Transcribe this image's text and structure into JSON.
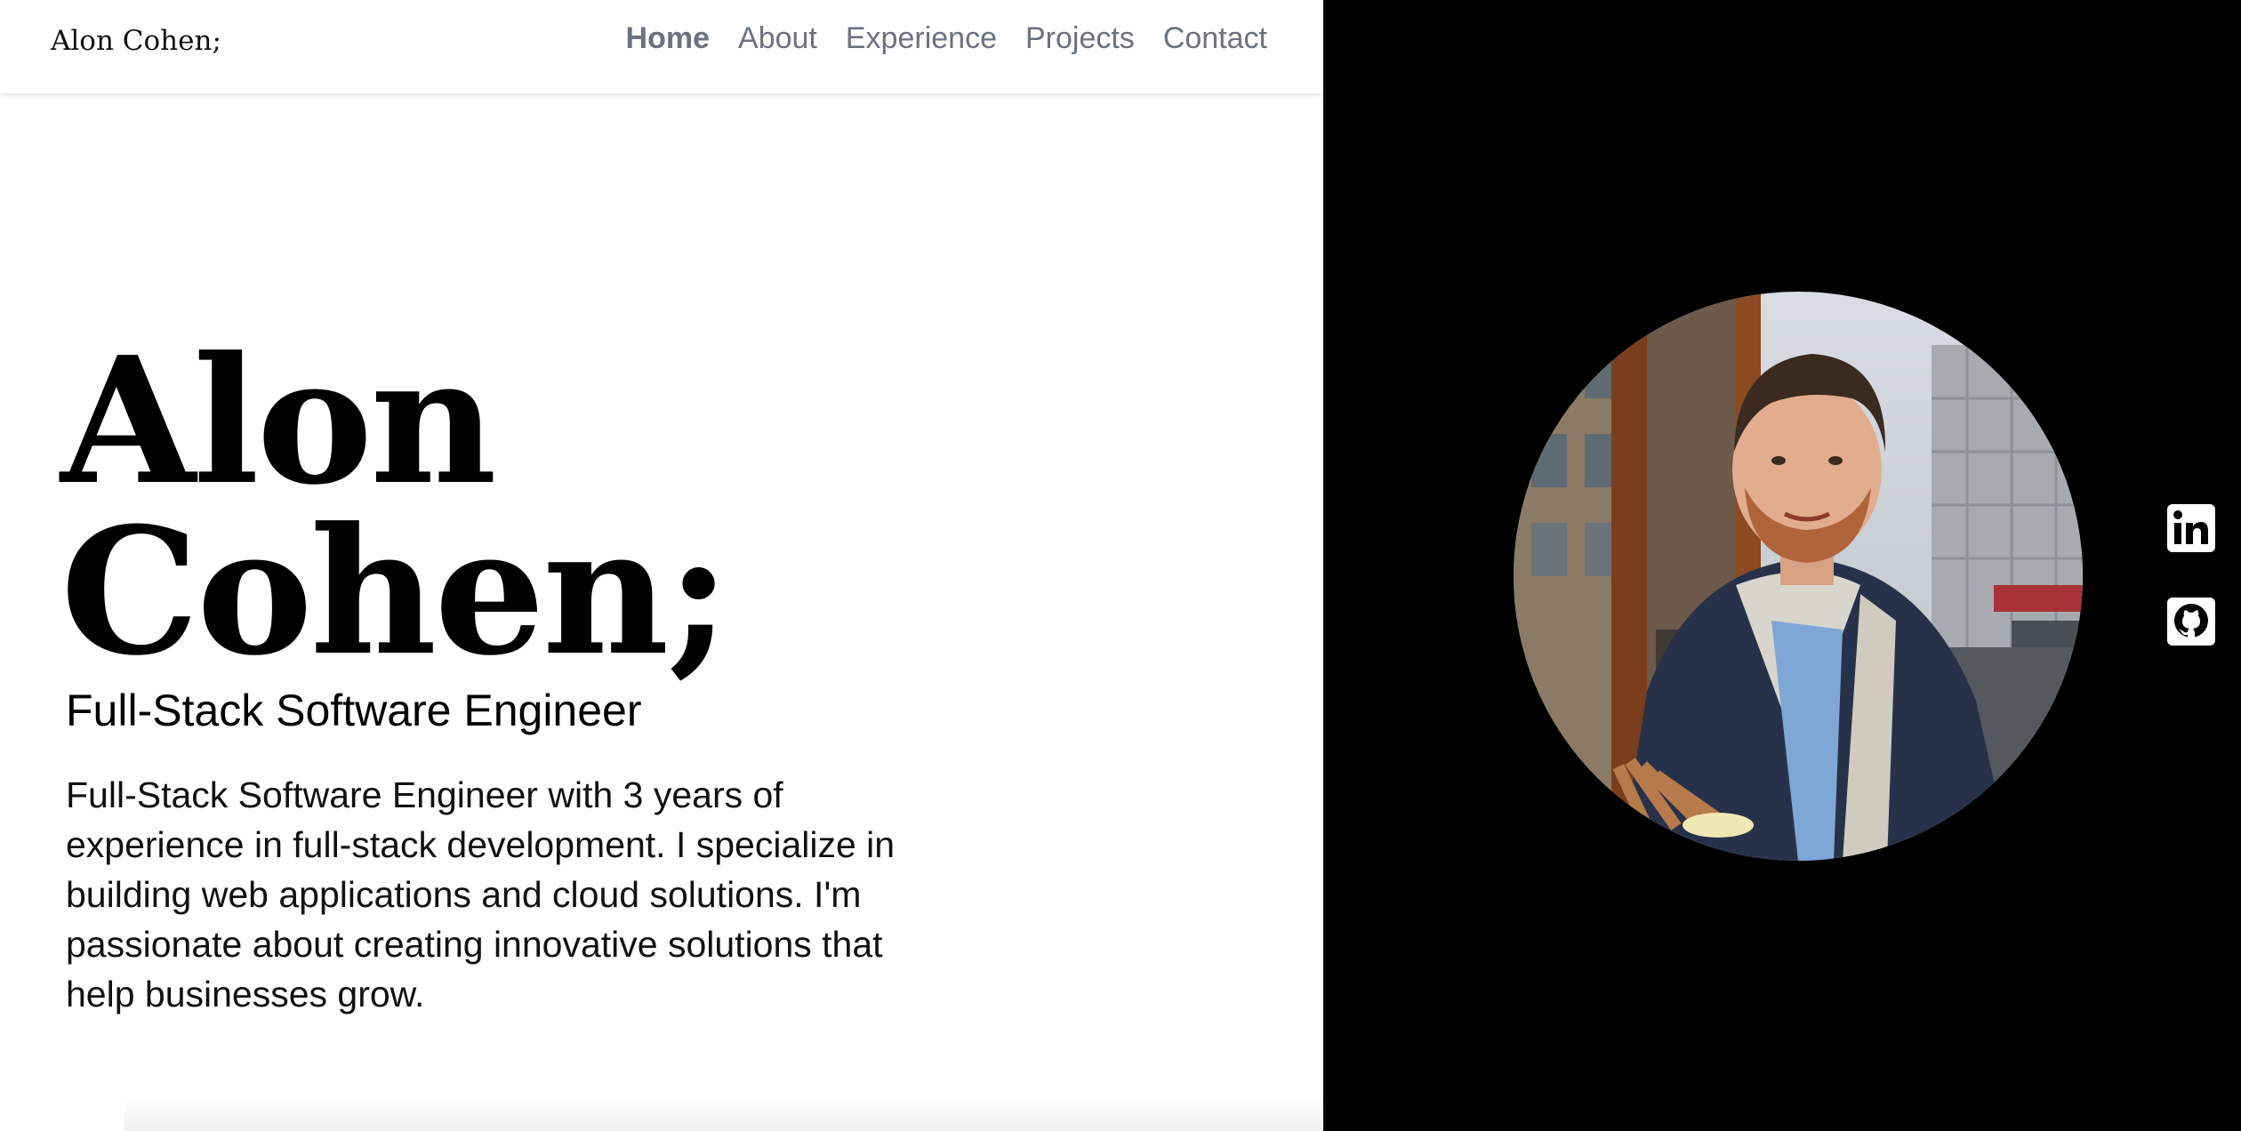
{
  "header": {
    "brand": "Alon Cohen;",
    "nav": [
      {
        "label": "Home",
        "active": true
      },
      {
        "label": "About",
        "active": false
      },
      {
        "label": "Experience",
        "active": false
      },
      {
        "label": "Projects",
        "active": false
      },
      {
        "label": "Contact",
        "active": false
      }
    ]
  },
  "hero": {
    "name_line1": "Alon",
    "name_line2": "Cohen;",
    "subtitle": "Full-Stack Software Engineer",
    "bio": "Full-Stack Software Engineer with 3 years of experience in full-stack development. I specialize in building web applications and cloud solutions. I'm passionate about creating innovative solutions that help businesses grow."
  },
  "side": {
    "social": [
      {
        "icon": "linkedin-icon"
      },
      {
        "icon": "github-icon"
      }
    ]
  },
  "colors": {
    "nav_text": "#6b7280",
    "left_bg": "#ffffff",
    "right_bg": "#000000"
  }
}
